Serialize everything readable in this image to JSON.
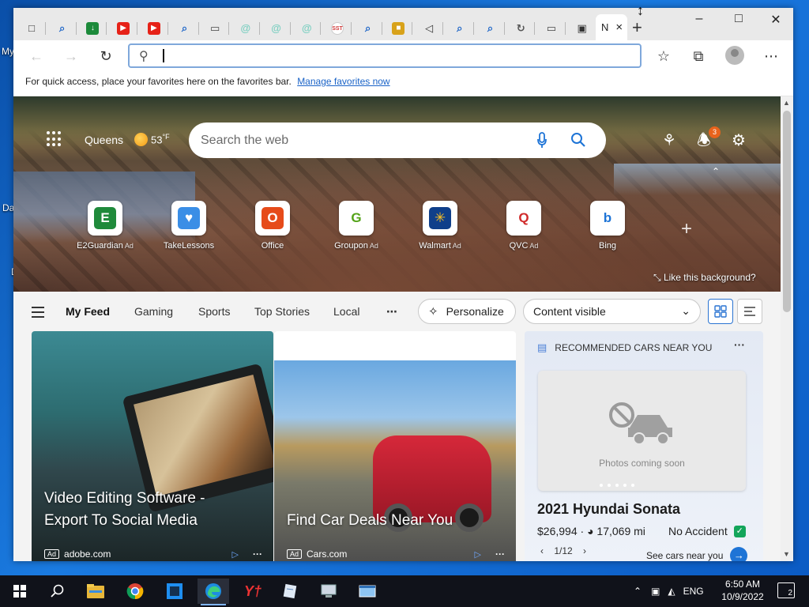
{
  "desktop": {
    "labels": [
      "My",
      "Da",
      "D"
    ]
  },
  "browser": {
    "tabs": [
      {
        "icon": "window-icon",
        "glyph": "□",
        "color": "#333333"
      },
      {
        "icon": "search-icon",
        "glyph": "⌕",
        "color": "#1a63c7"
      },
      {
        "icon": "download-icon",
        "glyph": "↓",
        "color": "#1c8a3a"
      },
      {
        "icon": "youtube-icon",
        "glyph": "▶",
        "color": "#e62117"
      },
      {
        "icon": "youtube-icon",
        "glyph": "▶",
        "color": "#e62117"
      },
      {
        "icon": "search-icon",
        "glyph": "⌕",
        "color": "#1a63c7"
      },
      {
        "icon": "page-icon",
        "glyph": "▭",
        "color": "#444444"
      },
      {
        "icon": "spiral-icon",
        "glyph": "@",
        "color": "#7ccfc1"
      },
      {
        "icon": "spiral-icon",
        "glyph": "@",
        "color": "#7ccfc1"
      },
      {
        "icon": "spiral-icon",
        "glyph": "@",
        "color": "#7ccfc1"
      },
      {
        "icon": "sst-icon",
        "glyph": "SST",
        "color": "#d03a3a"
      },
      {
        "icon": "search-icon",
        "glyph": "⌕",
        "color": "#1a63c7"
      },
      {
        "icon": "game-icon",
        "glyph": "■",
        "color": "#d8a21a"
      },
      {
        "icon": "speaker-icon",
        "glyph": "◁",
        "color": "#333333"
      },
      {
        "icon": "search-icon",
        "glyph": "⌕",
        "color": "#1a63c7"
      },
      {
        "icon": "search-icon",
        "glyph": "⌕",
        "color": "#1a63c7"
      },
      {
        "icon": "loading-icon",
        "glyph": "↻",
        "color": "#555555"
      },
      {
        "icon": "page-icon",
        "glyph": "▭",
        "color": "#444444"
      },
      {
        "icon": "calendar-icon",
        "glyph": "▣",
        "color": "#333333"
      }
    ],
    "active_tab": {
      "label": "N",
      "close": "×"
    },
    "new_tab": "+",
    "window_controls": {
      "minimize": "–",
      "maximize": "□",
      "close": "✕"
    },
    "toolbar": {
      "back": "←",
      "forward": "→",
      "refresh": "↻",
      "address_value": "",
      "address_placeholder": "",
      "favorite": "☆",
      "collections": "⧉",
      "menu": "⋯"
    },
    "favorites_bar": {
      "text": "For quick access, place your favorites here on the favorites bar.",
      "link": "Manage favorites now"
    }
  },
  "newtab": {
    "location": "Queens",
    "temperature": "53",
    "unit": "°F",
    "search_placeholder": "Search the web",
    "notification_count": "3",
    "quick_links": [
      {
        "label": "E2Guardian",
        "ad": "Ad",
        "icon": "e2guardian-icon",
        "glyph": "E",
        "bg": "#1f8a3b",
        "fg": "#ffffff"
      },
      {
        "label": "TakeLessons",
        "ad": "",
        "icon": "takelessons-icon",
        "glyph": "♥",
        "bg": "#3a8ee6",
        "fg": "#ffffff"
      },
      {
        "label": "Office",
        "ad": "",
        "icon": "office-icon",
        "glyph": "O",
        "bg": "#e64b1a",
        "fg": "#ffffff"
      },
      {
        "label": "Groupon",
        "ad": "Ad",
        "icon": "groupon-icon",
        "glyph": "G",
        "bg": "#ffffff",
        "fg": "#53a318"
      },
      {
        "label": "Walmart",
        "ad": "Ad",
        "icon": "walmart-icon",
        "glyph": "✳",
        "bg": "#0f3f8a",
        "fg": "#ffc220"
      },
      {
        "label": "QVC",
        "ad": "Ad",
        "icon": "qvc-icon",
        "glyph": "Q",
        "bg": "#ffffff",
        "fg": "#d02a2a"
      },
      {
        "label": "Bing",
        "ad": "",
        "icon": "bing-icon",
        "glyph": "b",
        "bg": "#ffffff",
        "fg": "#1e74d6"
      }
    ],
    "like_background": "Like this background?"
  },
  "feed_nav": {
    "items": [
      "My Feed",
      "Gaming",
      "Sports",
      "Top Stories",
      "Local"
    ],
    "more": "⋯",
    "personalize": "Personalize",
    "content_select": "Content visible"
  },
  "cards": [
    {
      "title": "Video Editing Software - Export To Social Media",
      "ad": "Ad",
      "source": "adobe.com"
    },
    {
      "title": "Find Car Deals Near You",
      "ad": "Ad",
      "source": "Cars.com"
    }
  ],
  "cars_card": {
    "header": "RECOMMENDED CARS NEAR YOU",
    "photo_text": "Photos coming soon",
    "model": "2021 Hyundai Sonata",
    "price": "$26,994",
    "mileage": "17,069 mi",
    "condition": "No Accident",
    "pager": "1/12",
    "see_cars": "See cars near you"
  },
  "taskbar": {
    "apps": [
      {
        "icon": "windows-start-icon",
        "active": false
      },
      {
        "icon": "search-icon",
        "active": false
      },
      {
        "icon": "file-explorer-icon",
        "active": false
      },
      {
        "icon": "chrome-icon",
        "active": false
      },
      {
        "icon": "store-icon",
        "active": false
      },
      {
        "icon": "edge-icon",
        "active": true
      },
      {
        "icon": "app-red-icon",
        "active": false
      },
      {
        "icon": "app-notepad-icon",
        "active": false
      },
      {
        "icon": "app-computer-icon",
        "active": false
      },
      {
        "icon": "app-window-icon",
        "active": false
      }
    ],
    "language": "ENG",
    "time": "6:50 AM",
    "date": "10/9/2022",
    "notifications": "2"
  }
}
